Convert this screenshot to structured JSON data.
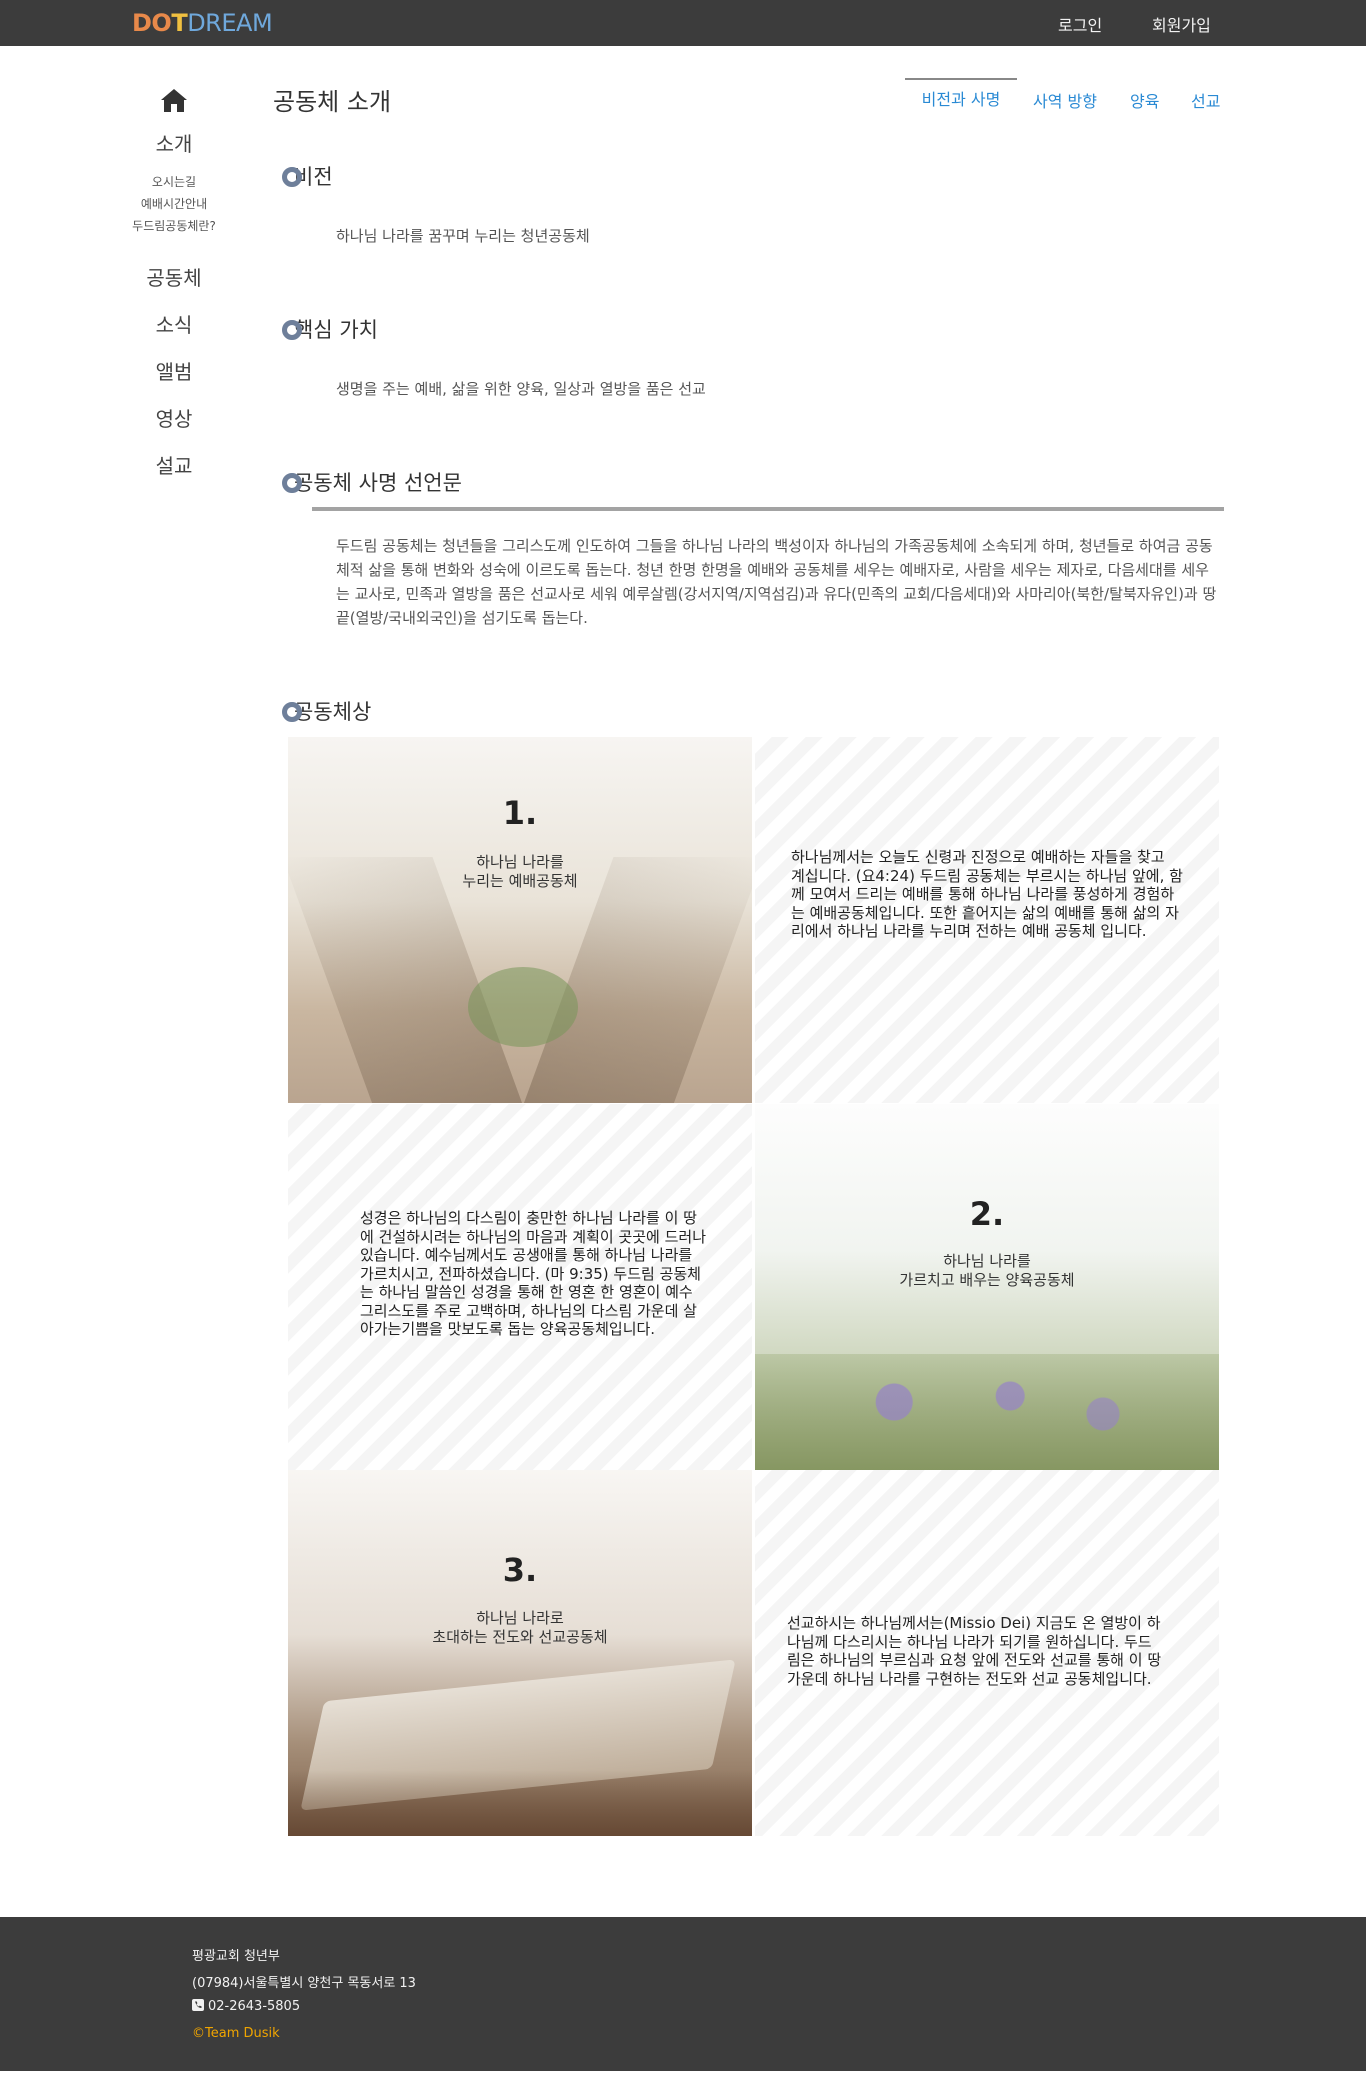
{
  "navbar": {
    "logo": {
      "part1": "DO",
      "cross": "T",
      "part2": "DREAM"
    },
    "login": "로그인",
    "signup": "회원가입"
  },
  "sidebar": {
    "home_icon": "home-icon",
    "intro": "소개",
    "intro_sub": [
      "오시는길",
      "예배시간안내",
      "두드림공동체란?"
    ],
    "items": [
      "공동체",
      "소식",
      "앨범",
      "영상",
      "설교"
    ]
  },
  "header": {
    "title": "공동체 소개",
    "tabs": [
      "비전과 사명",
      "사역 방향",
      "양육",
      "선교"
    ],
    "active_tab": "비전과 사명"
  },
  "sections": {
    "vision": {
      "title": "비전",
      "text": "하나님 나라를 꿈꾸며 누리는 청년공동체"
    },
    "values": {
      "title": "핵심 가치",
      "text": "생명을 주는 예배, 삶을 위한 양육, 일상과 열방을 품은 선교"
    },
    "mission": {
      "title": "공동체 사명 선언문",
      "text": "두드림 공동체는 청년들을 그리스도께 인도하여 그들을 하나님 나라의 백성이자 하나님의 가족공동체에 소속되게 하며, 청년들로 하여금 공동체적 삶을 통해 변화와 성숙에 이르도록 돕는다. 청년 한명 한명을 예배와 공동체를 세우는 예배자로, 사람을 세우는 제자로, 다음세대를 세우는 교사로, 민족과 열방을 품은 선교사로 세워 예루살렘(강서지역/지역섬김)과 유다(민족의 교회/다음세대)와 사마리아(북한/탈북자유인)과 땅 끝(열방/국내외국인)을 섬기도록 돕는다."
    },
    "vision_image": {
      "title": "공동체상"
    }
  },
  "cards": [
    {
      "number": "1.",
      "caption": "하나님 나라를\n누리는 예배공동체",
      "text": "하나님께서는 오늘도 신령과 진정으로 예배하는 자들을 찾고 계십니다. (요4:24) 두드림 공동체는 부르시는 하나님 앞에, 함께 모여서 드리는 예배를 통해 하나님 나라를 풍성하게 경험하는 예배공동체입니다. 또한 흩어지는 삶의 예배를 통해 삶의 자리에서 하나님 나라를 누리며 전하는 예배 공동체 입니다."
    },
    {
      "number": "2.",
      "caption": "하나님 나라를\n가르치고 배우는 양육공동체",
      "text": "성경은 하나님의 다스림이 충만한 하나님 나라를 이 땅에 건설하시려는 하나님의 마음과 계획이 곳곳에 드러나 있습니다. 예수님께서도 공생애를 통해 하나님 나라를 가르치시고, 전파하셨습니다. (마 9:35) 두드림 공동체는 하나님 말씀인 성경을 통해 한 영혼 한 영혼이 예수 그리스도를 주로 고백하며, 하나님의 다스림 가운데 살아가는기쁨을 맛보도록 돕는 양육공동체입니다."
    },
    {
      "number": "3.",
      "caption": "하나님 나라로\n초대하는 전도와 선교공동체",
      "text": "선교하시는 하나님께서는(Missio Dei) 지금도 온 열방이 하나님께 다스리시는 하나님 나라가 되기를 원하십니다. 두드림은 하나님의 부르심과 요청 앞에 전도와 선교를 통해 이 땅 가운데 하나님 나라를 구현하는 전도와 선교 공동체입니다."
    }
  ],
  "footer": {
    "org": "평광교회 청년부",
    "address": "(07984)서울특별시 양천구 목동서로 13",
    "phone_icon": "phone-icon",
    "phone": "02-2643-5805",
    "team": "©Team Dusik"
  }
}
